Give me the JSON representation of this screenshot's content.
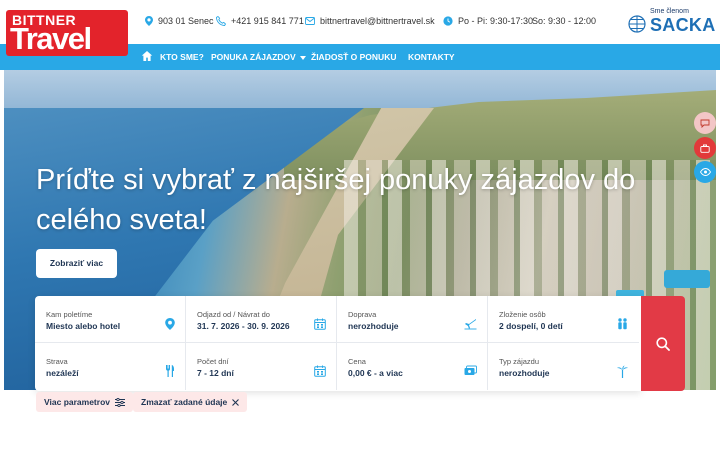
{
  "logo": {
    "line1": "BITTNER",
    "line2": "Travel"
  },
  "contacts": {
    "address": "903 01 Senec",
    "phone": "+421 915 841 771",
    "email": "bittnertravel@bittnertravel.sk",
    "hours_weekday": "Po - Pi: 9:30-17:30",
    "hours_saturday": "So: 9:30 - 12:00"
  },
  "sacka": {
    "caption": "Sme členom",
    "name": "SACKA"
  },
  "nav": {
    "items": [
      {
        "label": "KTO SME?"
      },
      {
        "label": "PONUKA ZÁJAZDOV"
      },
      {
        "label": "ŽIADOSŤ O PONUKU"
      },
      {
        "label": "KONTAKTY"
      }
    ]
  },
  "hero": {
    "title": "Príďte si vybrať z najširšej ponuky zájazdov do celého sveta!",
    "button": "Zobraziť viac"
  },
  "search": {
    "fields": [
      {
        "label": "Kam poletíme",
        "value": "Miesto alebo hotel",
        "icon": "location-pin-icon"
      },
      {
        "label": "Odjazd od / Návrat do",
        "value": "31. 7. 2026 - 30. 9. 2026",
        "icon": "calendar-icon"
      },
      {
        "label": "Doprava",
        "value": "nerozhoduje",
        "icon": "plane-icon"
      },
      {
        "label": "Zloženie osôb",
        "value": "2 dospelí, 0 detí",
        "icon": "people-icon"
      },
      {
        "label": "Strava",
        "value": "nezáleží",
        "icon": "cutlery-icon"
      },
      {
        "label": "Počet dní",
        "value": "7 - 12 dní",
        "icon": "calendar-icon"
      },
      {
        "label": "Cena",
        "value": "0,00 € - a viac",
        "icon": "money-icon"
      },
      {
        "label": "Typ zájazdu",
        "value": "nerozhoduje",
        "icon": "palm-icon"
      }
    ]
  },
  "chips": {
    "more_params": "Viac parametrov",
    "clear": "Zmazať zadané údaje"
  },
  "colors": {
    "brand_red": "#e3232b",
    "nav_blue": "#29a8e6",
    "search_red": "#e23a46",
    "text_dark": "#1f3553"
  }
}
